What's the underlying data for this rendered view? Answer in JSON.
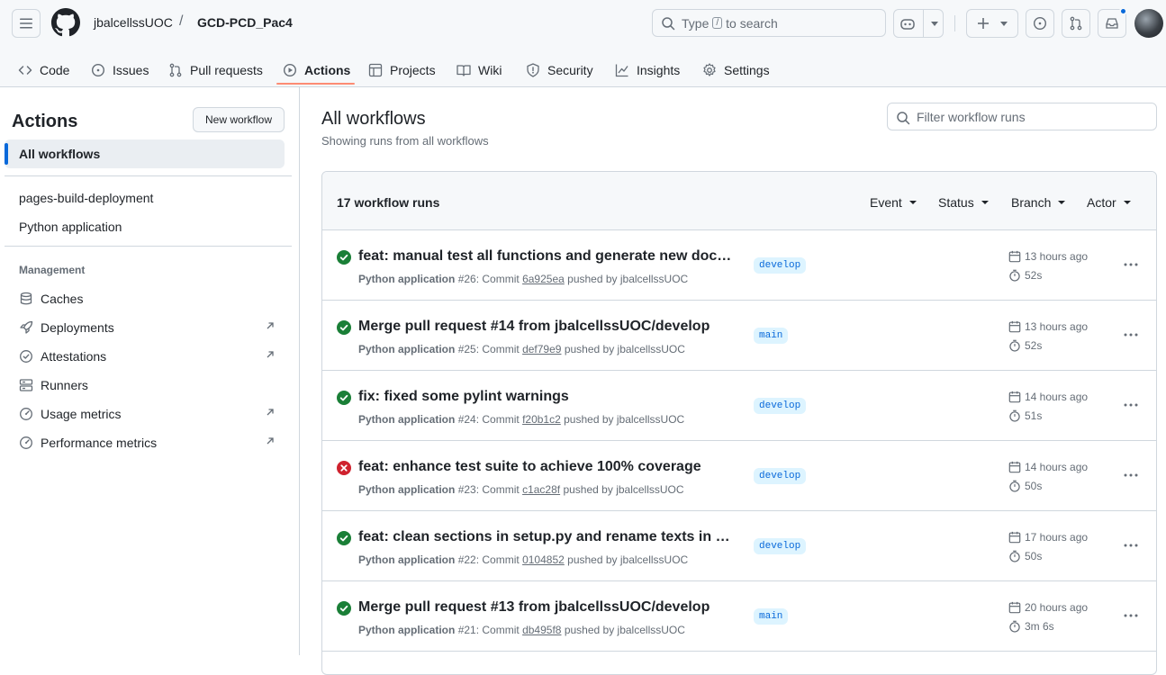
{
  "header": {
    "owner": "jbalcellssUOC",
    "separator": "/",
    "repo": "GCD-PCD_Pac4",
    "search_prefix": "Type",
    "search_key": "/",
    "search_suffix": "to search"
  },
  "tabs": [
    {
      "label": "Code",
      "icon": "code-icon"
    },
    {
      "label": "Issues",
      "icon": "issue-icon"
    },
    {
      "label": "Pull requests",
      "icon": "pull-request-icon"
    },
    {
      "label": "Actions",
      "icon": "play-icon",
      "active": true
    },
    {
      "label": "Projects",
      "icon": "table-icon"
    },
    {
      "label": "Wiki",
      "icon": "book-icon"
    },
    {
      "label": "Security",
      "icon": "shield-icon"
    },
    {
      "label": "Insights",
      "icon": "graph-icon"
    },
    {
      "label": "Settings",
      "icon": "gear-icon"
    }
  ],
  "sidebar": {
    "title": "Actions",
    "new_workflow": "New workflow",
    "all_workflows": "All workflows",
    "workflows": [
      "pages-build-deployment",
      "Python application"
    ],
    "management_heading": "Management",
    "management": [
      {
        "label": "Caches",
        "icon": "database-icon",
        "external": false
      },
      {
        "label": "Deployments",
        "icon": "rocket-icon",
        "external": true
      },
      {
        "label": "Attestations",
        "icon": "verified-icon",
        "external": true
      },
      {
        "label": "Runners",
        "icon": "server-icon",
        "external": false
      },
      {
        "label": "Usage metrics",
        "icon": "meter-icon",
        "external": true
      },
      {
        "label": "Performance metrics",
        "icon": "meter-icon",
        "external": true
      }
    ]
  },
  "main": {
    "title": "All workflows",
    "subtitle": "Showing runs from all workflows",
    "filter_placeholder": "Filter workflow runs",
    "runs_count": "17 workflow runs",
    "filters": [
      "Event",
      "Status",
      "Branch",
      "Actor"
    ],
    "runs": [
      {
        "status": "success",
        "title": "feat: manual test all functions and generate new documentation",
        "workflow": "Python application",
        "number": "#26",
        "commit_label": "Commit",
        "commit": "6a925ea",
        "pushed_by": "pushed by",
        "author": "jbalcellssUOC",
        "branch": "develop",
        "when": "13 hours ago",
        "duration": "52s"
      },
      {
        "status": "success",
        "title": "Merge pull request #14 from jbalcellssUOC/develop",
        "workflow": "Python application",
        "number": "#25",
        "commit_label": "Commit",
        "commit": "def79e9",
        "pushed_by": "pushed by",
        "author": "jbalcellssUOC",
        "branch": "main",
        "when": "13 hours ago",
        "duration": "52s"
      },
      {
        "status": "success",
        "title": "fix: fixed some pylint warnings",
        "workflow": "Python application",
        "number": "#24",
        "commit_label": "Commit",
        "commit": "f20b1c2",
        "pushed_by": "pushed by",
        "author": "jbalcellssUOC",
        "branch": "develop",
        "when": "14 hours ago",
        "duration": "51s"
      },
      {
        "status": "failure",
        "title": "feat: enhance test suite to achieve 100% coverage",
        "workflow": "Python application",
        "number": "#23",
        "commit_label": "Commit",
        "commit": "c1ac28f",
        "pushed_by": "pushed by",
        "author": "jbalcellssUOC",
        "branch": "develop",
        "when": "14 hours ago",
        "duration": "50s"
      },
      {
        "status": "success",
        "title": "feat: clean sections in setup.py and rename texts in cd-pipeline",
        "workflow": "Python application",
        "number": "#22",
        "commit_label": "Commit",
        "commit": "0104852",
        "pushed_by": "pushed by",
        "author": "jbalcellssUOC",
        "branch": "develop",
        "when": "17 hours ago",
        "duration": "50s"
      },
      {
        "status": "success",
        "title": "Merge pull request #13 from jbalcellssUOC/develop",
        "workflow": "Python application",
        "number": "#21",
        "commit_label": "Commit",
        "commit": "db495f8",
        "pushed_by": "pushed by",
        "author": "jbalcellssUOC",
        "branch": "main",
        "when": "20 hours ago",
        "duration": "3m 6s"
      }
    ]
  },
  "colors": {
    "success": "#1a7f37",
    "failure": "#cf222e",
    "accent": "#0969da",
    "tab_underline": "#fd8c73"
  }
}
